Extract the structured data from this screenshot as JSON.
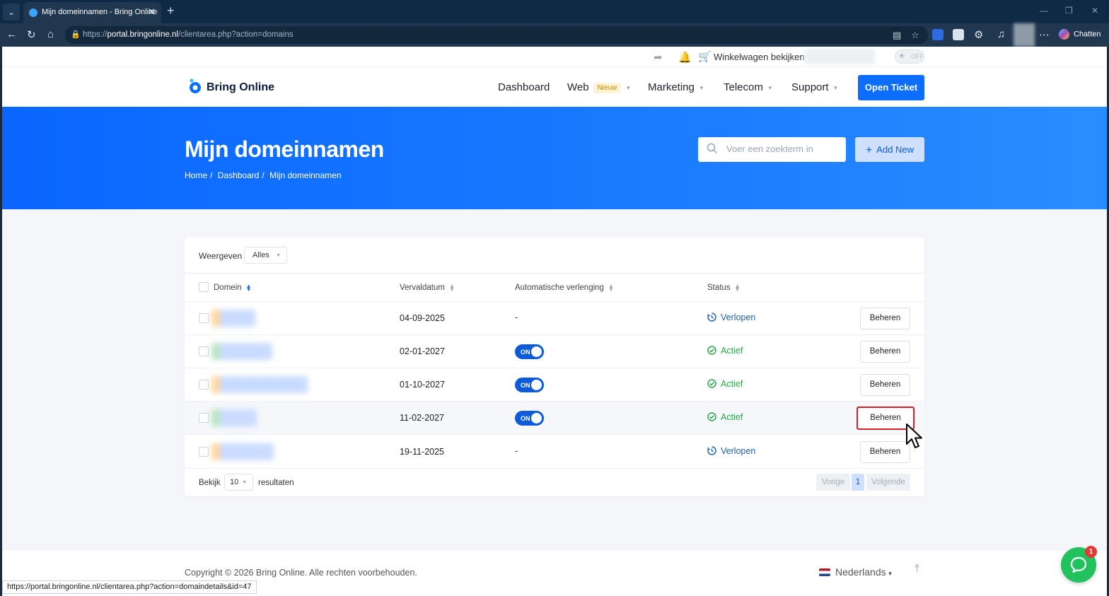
{
  "browser": {
    "tab_title": "Mijn domeinnamen - Bring Online",
    "url_prefix": "https://",
    "url_host": "portal.bringonline.nl",
    "url_path": "/clientarea.php?action=domains",
    "chat_label": "Chatten",
    "status_url": "https://portal.bringonline.nl/clientarea.php?action=domaindetails&id=47"
  },
  "topbar": {
    "cart_label": "Winkelwagen bekijken",
    "theme_toggle": "OFF"
  },
  "brand": {
    "name": "Bring Online",
    "color": "#0d6efd"
  },
  "nav": {
    "items": [
      {
        "label": "Dashboard"
      },
      {
        "label": "Web",
        "badge": "Nieuw"
      },
      {
        "label": "Marketing"
      },
      {
        "label": "Telecom"
      },
      {
        "label": "Support"
      }
    ],
    "cta_label": "Open Ticket"
  },
  "hero": {
    "title": "Mijn domeinnamen",
    "breadcrumb": [
      "Home",
      "/",
      "Dashboard",
      "/",
      "Mijn domeinnamen"
    ],
    "search_placeholder": "Voer een zoekterm in",
    "add_new_label": "Add New"
  },
  "table": {
    "filter_label": "Weergeven",
    "filter_value": "Alles",
    "columns": [
      "Domein",
      "Vervaldatum",
      "Automatische verlenging",
      "Status"
    ],
    "rows": [
      {
        "domain_color": "#ffd7a0",
        "expiry": "04-09-2025",
        "auto_renew": "-",
        "status": "Verlopen",
        "action": "Beheren"
      },
      {
        "domain_color": "#b9e6c1",
        "expiry": "02-01-2027",
        "auto_renew": "ON",
        "status": "Actief",
        "action": "Beheren"
      },
      {
        "domain_color": "#ffd7a0",
        "expiry": "01-10-2027",
        "auto_renew": "ON",
        "status": "Actief",
        "action": "Beheren"
      },
      {
        "domain_color": "#b9e6c1",
        "expiry": "11-02-2027",
        "auto_renew": "ON",
        "status": "Actief",
        "action": "Beheren"
      },
      {
        "domain_color": "#ffd7a0",
        "expiry": "19-11-2025",
        "auto_renew": "-",
        "status": "Verlopen",
        "action": "Beheren"
      }
    ],
    "footer": {
      "show_label": "Bekijk",
      "page_size": "10",
      "results_label": "resultaten",
      "prev_label": "Vorige",
      "current_page": "1",
      "next_label": "Volgende"
    }
  },
  "footer": {
    "copyright": "Copyright © 2026 Bring Online. Alle rechten voorbehouden.",
    "language": "Nederlands"
  },
  "chat_widget": {
    "badge_count": "1"
  },
  "colors": {
    "accent": "#0d6efd",
    "status_active": "#28a745",
    "status_expired": "#1f5fa8",
    "highlight": "#d61f26"
  }
}
